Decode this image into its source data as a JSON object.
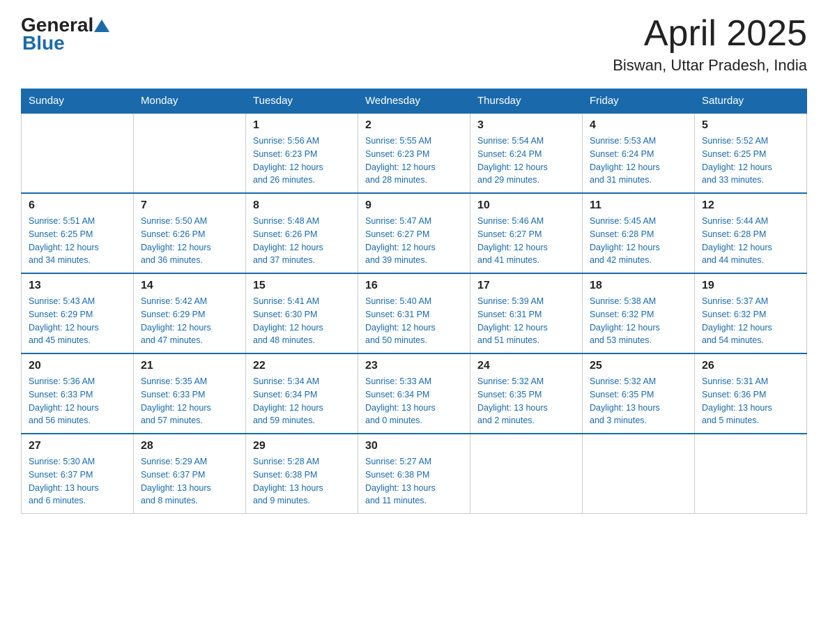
{
  "header": {
    "logo_general": "General",
    "logo_blue": "Blue",
    "month_title": "April 2025",
    "location": "Biswan, Uttar Pradesh, India"
  },
  "weekdays": [
    "Sunday",
    "Monday",
    "Tuesday",
    "Wednesday",
    "Thursday",
    "Friday",
    "Saturday"
  ],
  "weeks": [
    [
      {
        "day": "",
        "info": ""
      },
      {
        "day": "",
        "info": ""
      },
      {
        "day": "1",
        "info": "Sunrise: 5:56 AM\nSunset: 6:23 PM\nDaylight: 12 hours\nand 26 minutes."
      },
      {
        "day": "2",
        "info": "Sunrise: 5:55 AM\nSunset: 6:23 PM\nDaylight: 12 hours\nand 28 minutes."
      },
      {
        "day": "3",
        "info": "Sunrise: 5:54 AM\nSunset: 6:24 PM\nDaylight: 12 hours\nand 29 minutes."
      },
      {
        "day": "4",
        "info": "Sunrise: 5:53 AM\nSunset: 6:24 PM\nDaylight: 12 hours\nand 31 minutes."
      },
      {
        "day": "5",
        "info": "Sunrise: 5:52 AM\nSunset: 6:25 PM\nDaylight: 12 hours\nand 33 minutes."
      }
    ],
    [
      {
        "day": "6",
        "info": "Sunrise: 5:51 AM\nSunset: 6:25 PM\nDaylight: 12 hours\nand 34 minutes."
      },
      {
        "day": "7",
        "info": "Sunrise: 5:50 AM\nSunset: 6:26 PM\nDaylight: 12 hours\nand 36 minutes."
      },
      {
        "day": "8",
        "info": "Sunrise: 5:48 AM\nSunset: 6:26 PM\nDaylight: 12 hours\nand 37 minutes."
      },
      {
        "day": "9",
        "info": "Sunrise: 5:47 AM\nSunset: 6:27 PM\nDaylight: 12 hours\nand 39 minutes."
      },
      {
        "day": "10",
        "info": "Sunrise: 5:46 AM\nSunset: 6:27 PM\nDaylight: 12 hours\nand 41 minutes."
      },
      {
        "day": "11",
        "info": "Sunrise: 5:45 AM\nSunset: 6:28 PM\nDaylight: 12 hours\nand 42 minutes."
      },
      {
        "day": "12",
        "info": "Sunrise: 5:44 AM\nSunset: 6:28 PM\nDaylight: 12 hours\nand 44 minutes."
      }
    ],
    [
      {
        "day": "13",
        "info": "Sunrise: 5:43 AM\nSunset: 6:29 PM\nDaylight: 12 hours\nand 45 minutes."
      },
      {
        "day": "14",
        "info": "Sunrise: 5:42 AM\nSunset: 6:29 PM\nDaylight: 12 hours\nand 47 minutes."
      },
      {
        "day": "15",
        "info": "Sunrise: 5:41 AM\nSunset: 6:30 PM\nDaylight: 12 hours\nand 48 minutes."
      },
      {
        "day": "16",
        "info": "Sunrise: 5:40 AM\nSunset: 6:31 PM\nDaylight: 12 hours\nand 50 minutes."
      },
      {
        "day": "17",
        "info": "Sunrise: 5:39 AM\nSunset: 6:31 PM\nDaylight: 12 hours\nand 51 minutes."
      },
      {
        "day": "18",
        "info": "Sunrise: 5:38 AM\nSunset: 6:32 PM\nDaylight: 12 hours\nand 53 minutes."
      },
      {
        "day": "19",
        "info": "Sunrise: 5:37 AM\nSunset: 6:32 PM\nDaylight: 12 hours\nand 54 minutes."
      }
    ],
    [
      {
        "day": "20",
        "info": "Sunrise: 5:36 AM\nSunset: 6:33 PM\nDaylight: 12 hours\nand 56 minutes."
      },
      {
        "day": "21",
        "info": "Sunrise: 5:35 AM\nSunset: 6:33 PM\nDaylight: 12 hours\nand 57 minutes."
      },
      {
        "day": "22",
        "info": "Sunrise: 5:34 AM\nSunset: 6:34 PM\nDaylight: 12 hours\nand 59 minutes."
      },
      {
        "day": "23",
        "info": "Sunrise: 5:33 AM\nSunset: 6:34 PM\nDaylight: 13 hours\nand 0 minutes."
      },
      {
        "day": "24",
        "info": "Sunrise: 5:32 AM\nSunset: 6:35 PM\nDaylight: 13 hours\nand 2 minutes."
      },
      {
        "day": "25",
        "info": "Sunrise: 5:32 AM\nSunset: 6:35 PM\nDaylight: 13 hours\nand 3 minutes."
      },
      {
        "day": "26",
        "info": "Sunrise: 5:31 AM\nSunset: 6:36 PM\nDaylight: 13 hours\nand 5 minutes."
      }
    ],
    [
      {
        "day": "27",
        "info": "Sunrise: 5:30 AM\nSunset: 6:37 PM\nDaylight: 13 hours\nand 6 minutes."
      },
      {
        "day": "28",
        "info": "Sunrise: 5:29 AM\nSunset: 6:37 PM\nDaylight: 13 hours\nand 8 minutes."
      },
      {
        "day": "29",
        "info": "Sunrise: 5:28 AM\nSunset: 6:38 PM\nDaylight: 13 hours\nand 9 minutes."
      },
      {
        "day": "30",
        "info": "Sunrise: 5:27 AM\nSunset: 6:38 PM\nDaylight: 13 hours\nand 11 minutes."
      },
      {
        "day": "",
        "info": ""
      },
      {
        "day": "",
        "info": ""
      },
      {
        "day": "",
        "info": ""
      }
    ]
  ]
}
